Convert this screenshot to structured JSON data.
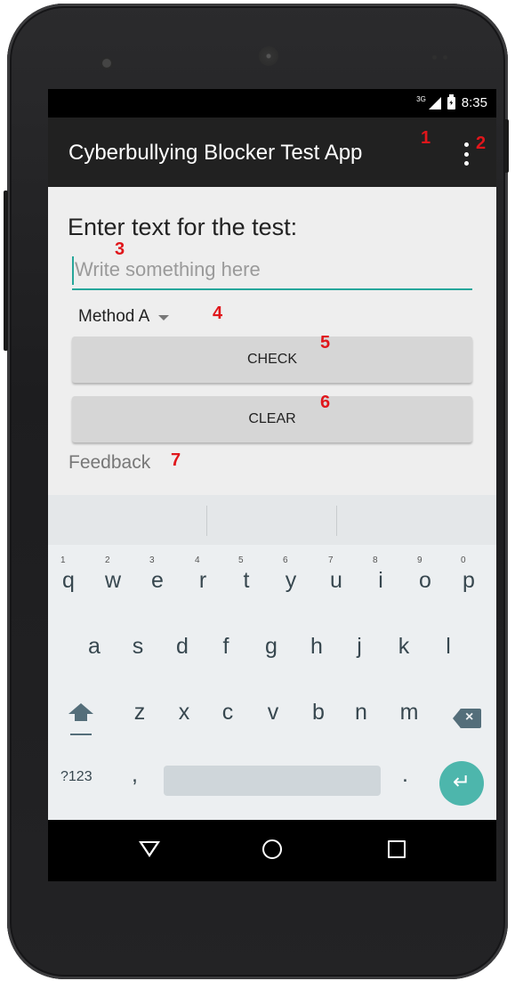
{
  "status_bar": {
    "network": "3G",
    "time": "8:35"
  },
  "app_bar": {
    "title": "Cyberbullying Blocker Test App",
    "overflow_icon": "more-vert-icon"
  },
  "form": {
    "prompt": "Enter text for the test:",
    "text_input": {
      "value": "",
      "placeholder": "Write something here"
    },
    "method_select": {
      "selected": "Method A"
    },
    "check_label": "CHECK",
    "clear_label": "CLEAR",
    "feedback": "Feedback"
  },
  "annotations": [
    "1",
    "2",
    "3",
    "4",
    "5",
    "6",
    "7"
  ],
  "keyboard": {
    "row1": [
      {
        "key": "q",
        "hint": "1"
      },
      {
        "key": "w",
        "hint": "2"
      },
      {
        "key": "e",
        "hint": "3"
      },
      {
        "key": "r",
        "hint": "4"
      },
      {
        "key": "t",
        "hint": "5"
      },
      {
        "key": "y",
        "hint": "6"
      },
      {
        "key": "u",
        "hint": "7"
      },
      {
        "key": "i",
        "hint": "8"
      },
      {
        "key": "o",
        "hint": "9"
      },
      {
        "key": "p",
        "hint": "0"
      }
    ],
    "row2": [
      "a",
      "s",
      "d",
      "f",
      "g",
      "h",
      "j",
      "k",
      "l"
    ],
    "row3": [
      "z",
      "x",
      "c",
      "v",
      "b",
      "n",
      "m"
    ],
    "symbols_label": "?123",
    "comma": ",",
    "period": ".",
    "enter_icon": "enter-icon",
    "shift_icon": "shift-icon",
    "backspace_icon": "backspace-icon"
  },
  "colors": {
    "accent": "#26a69a",
    "app_bar": "#212121",
    "annotation": "#e0161b",
    "enter_key": "#4db6ac"
  }
}
